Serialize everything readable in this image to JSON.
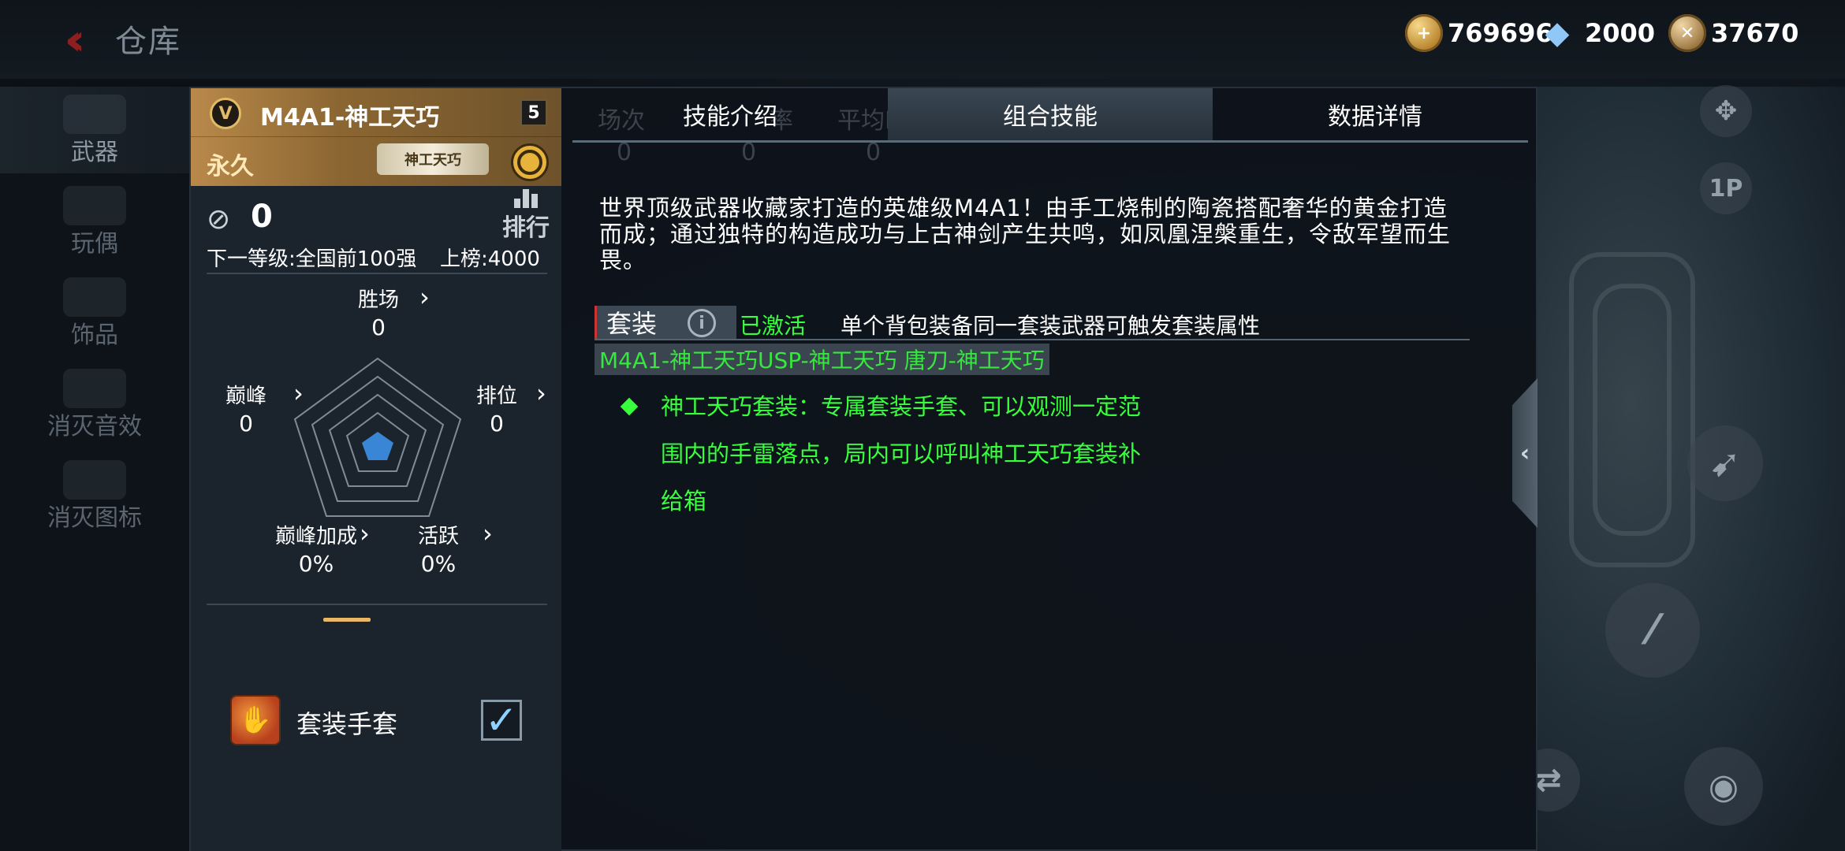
{
  "topbar": {
    "title": "仓库",
    "currencies": [
      {
        "icon": "gold-coin-icon",
        "value": "769696"
      },
      {
        "icon": "diamond-icon",
        "value": "2000"
      },
      {
        "icon": "medal-coin-icon",
        "value": "37670"
      }
    ]
  },
  "nav": {
    "items": [
      {
        "label": "武器",
        "active": true
      },
      {
        "label": "玩偶"
      },
      {
        "label": "饰品"
      },
      {
        "label": "消灭音效"
      },
      {
        "label": "消灭图标"
      }
    ]
  },
  "card": {
    "weapon_name": "M4A1-神工天巧",
    "level": "5",
    "duration": "永久",
    "weapon_tag": "神工天巧",
    "kills": "0",
    "rank_label": "排行",
    "next_level": "下一等级:全国前100强",
    "listed": "上榜:4000",
    "stats": [
      {
        "label": "胜场",
        "value": "0"
      },
      {
        "label": "排位",
        "value": "0"
      },
      {
        "label": "活跃",
        "value": "0%"
      },
      {
        "label": "巅峰加成",
        "value": "0%"
      },
      {
        "label": "巅峰",
        "value": "0"
      }
    ],
    "gloves_label": "套装手套",
    "gloves_checked": true
  },
  "tabs": [
    {
      "label": "技能介绍",
      "active": false
    },
    {
      "label": "组合技能",
      "active": true
    },
    {
      "label": "数据详情",
      "active": false
    }
  ],
  "ghost_headers": [
    "场次",
    "率",
    "平均KDA"
  ],
  "ghost_values": [
    "0",
    "0",
    "0"
  ],
  "description": "世界顶级武器收藏家打造的英雄级M4A1！由手工烧制的陶瓷搭配奢华的黄金打造而成；通过独特的构造成功与上古神剑产生共鸣，如凤凰涅槃重生，令敌军望而生畏。",
  "suit": {
    "label": "套装",
    "status": "已激活",
    "note": "单个背包装备同一套装武器可触发套装属性",
    "items": "M4A1-神工天巧USP-神工天巧 唐刀-神工天巧",
    "effect": "神工天巧套装：专属套装手套、可以观测一定范围内的手雷落点，局内可以呼叫神工天巧套装补给箱"
  },
  "hud": {
    "view_label": "1P"
  },
  "colors": {
    "accent_green": "#37ff3c",
    "gold": "#b9894a",
    "back_red": "#8d1f1f"
  }
}
